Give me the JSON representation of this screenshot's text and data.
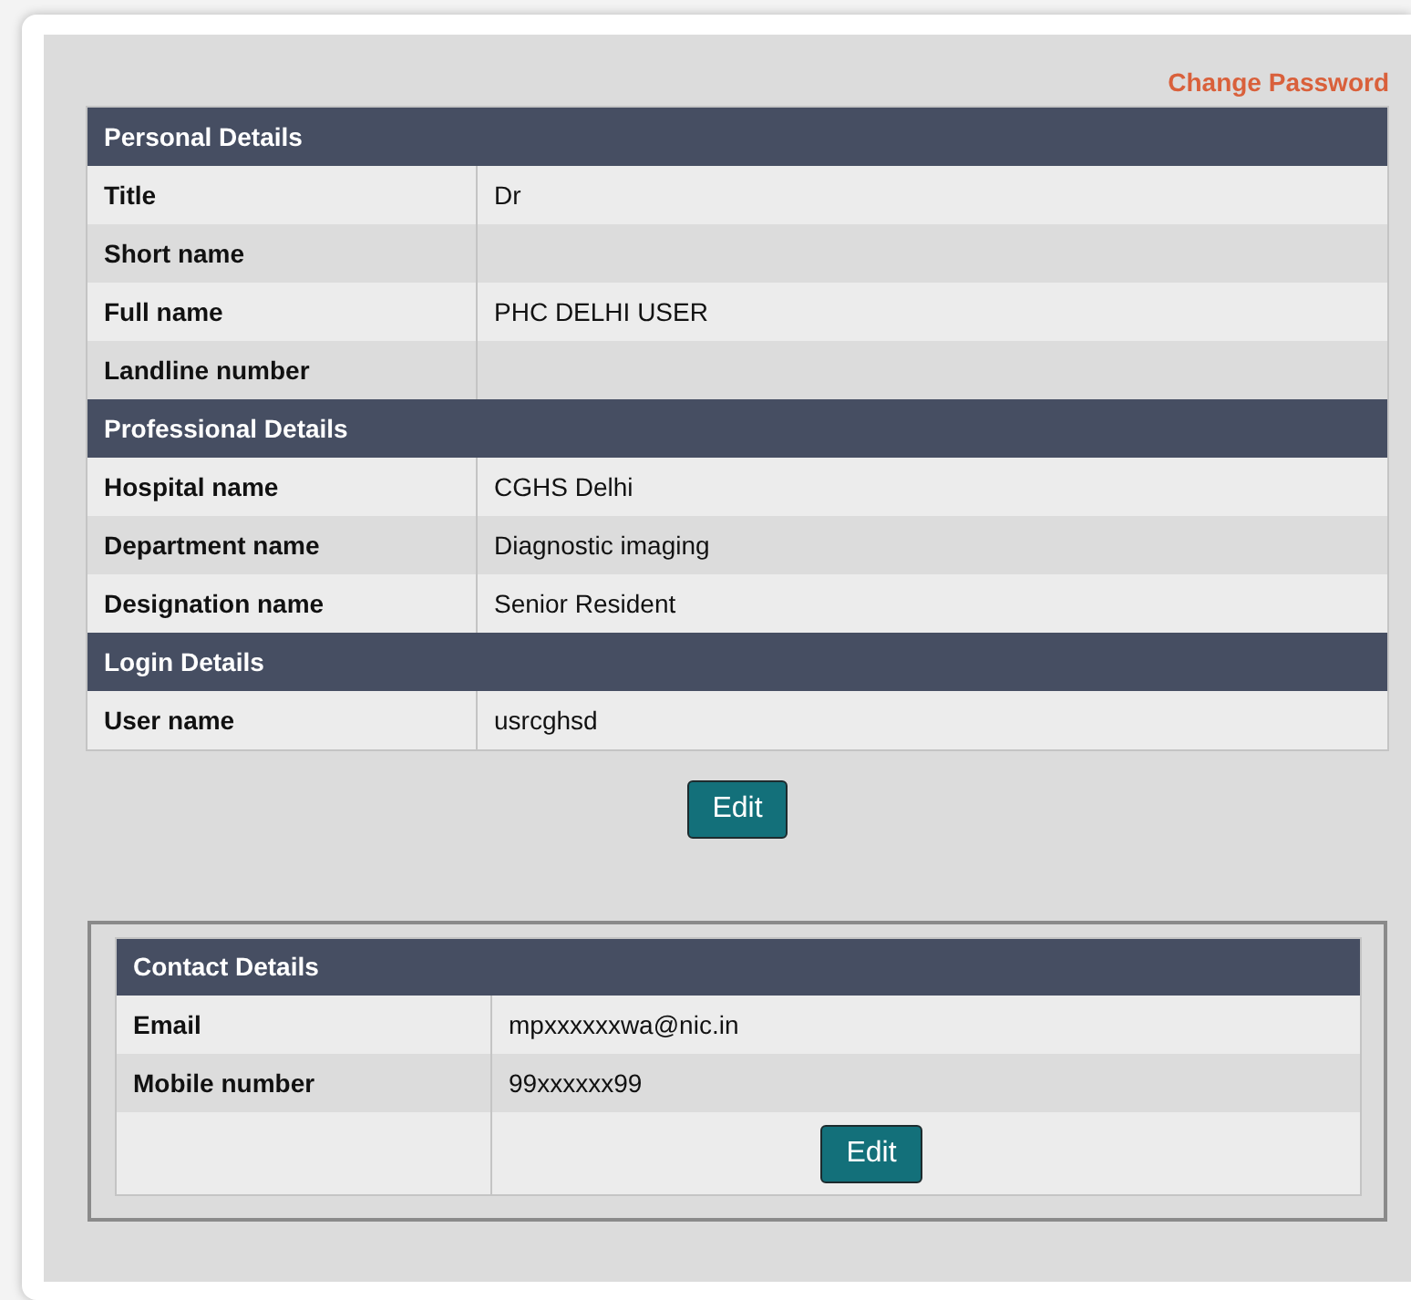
{
  "change_password_link": "Change Password",
  "profile_sections": [
    {
      "heading": "Personal Details",
      "rows": [
        {
          "label": "Title",
          "value": "Dr"
        },
        {
          "label": "Short name",
          "value": ""
        },
        {
          "label": "Full name",
          "value": "PHC DELHI USER"
        },
        {
          "label": "Landline number",
          "value": ""
        }
      ]
    },
    {
      "heading": "Professional Details",
      "rows": [
        {
          "label": "Hospital name",
          "value": "CGHS Delhi"
        },
        {
          "label": "Department name",
          "value": "Diagnostic imaging"
        },
        {
          "label": "Designation name",
          "value": "Senior Resident"
        }
      ]
    },
    {
      "heading": "Login Details",
      "rows": [
        {
          "label": "User name",
          "value": "usrcghsd"
        }
      ]
    }
  ],
  "profile_edit_button": "Edit",
  "contact": {
    "heading": "Contact Details",
    "rows": [
      {
        "label": "Email",
        "value": "mpxxxxxxwa@nic.in"
      },
      {
        "label": "Mobile number",
        "value": "99xxxxxx99"
      }
    ],
    "edit_button": "Edit"
  }
}
